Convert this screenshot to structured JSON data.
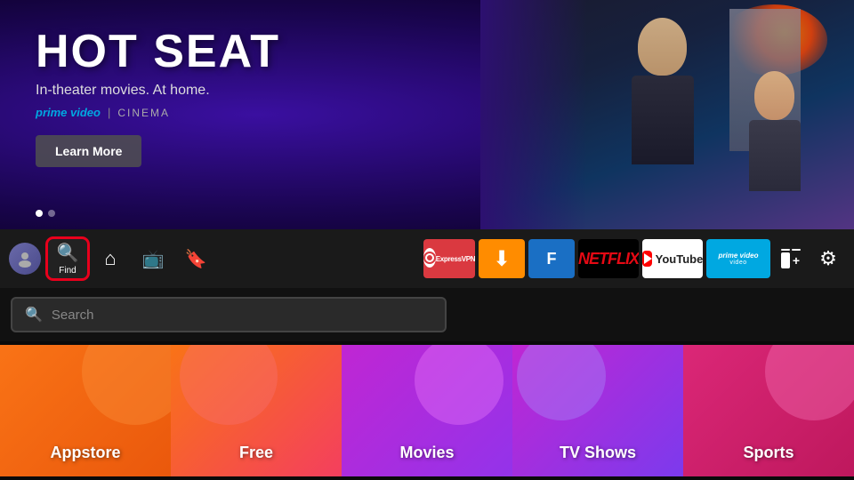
{
  "hero": {
    "title": "HOT SEAT",
    "subtitle": "In-theater movies. At home.",
    "brand_prime": "prime video",
    "brand_divider": "|",
    "brand_cinema": "CINEMA",
    "learn_more": "Learn More",
    "dots": [
      {
        "active": true
      },
      {
        "active": false
      }
    ]
  },
  "navbar": {
    "avatar_label": "profile-avatar",
    "find_label": "Find",
    "home_label": "Home",
    "live_label": "Live",
    "watchlist_label": "Watchlist",
    "apps": {
      "expressvpn": "ExpressVPN",
      "downloader": "Downloader",
      "app2": "App",
      "netflix": "NETFLIX",
      "youtube": "YouTube",
      "prime_video": "prime video",
      "prime_video_sub": "video"
    }
  },
  "search": {
    "placeholder": "Search"
  },
  "categories": [
    {
      "id": "appstore",
      "label": "Appstore"
    },
    {
      "id": "free",
      "label": "Free"
    },
    {
      "id": "movies",
      "label": "Movies"
    },
    {
      "id": "tvshows",
      "label": "TV Shows"
    },
    {
      "id": "sports",
      "label": "Sports"
    }
  ],
  "icons": {
    "search": "🔍",
    "home": "⌂",
    "live": "📺",
    "bookmark": "🔖",
    "gear": "⚙",
    "download_arrow": "⬇"
  }
}
